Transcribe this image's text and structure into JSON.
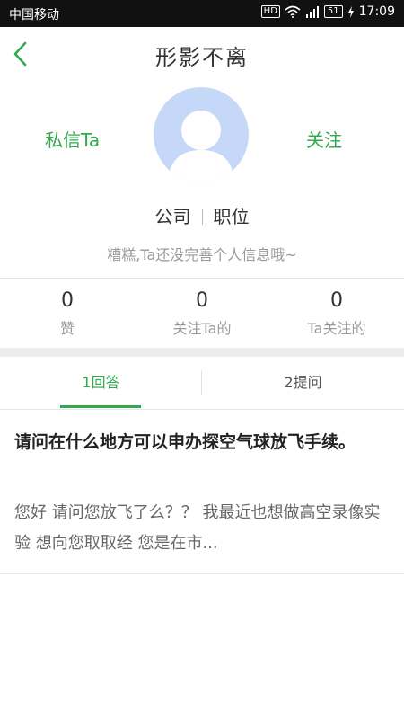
{
  "status_bar": {
    "carrier": "中国移动",
    "hd": "HD",
    "battery": "51",
    "time": "17:09"
  },
  "header": {
    "title": "形影不离",
    "back_icon": "chevron-left-icon"
  },
  "profile": {
    "message_label": "私信Ta",
    "follow_label": "关注",
    "company": "公司",
    "position": "职位",
    "bio": "糟糕,Ta还没完善个人信息哦~"
  },
  "stats": [
    {
      "value": "0",
      "label": "赞"
    },
    {
      "value": "0",
      "label": "关注Ta的"
    },
    {
      "value": "0",
      "label": "Ta关注的"
    }
  ],
  "tabs": [
    {
      "label": "1回答",
      "active": true
    },
    {
      "label": "2提问",
      "active": false
    }
  ],
  "answers": [
    {
      "question": "请问在什么地方可以申办探空气球放飞手续。",
      "excerpt": "您好   请问您放飞了么？？   我最近也想做高空录像实验    想向您取取经   您是在市..."
    }
  ],
  "colors": {
    "accent": "#2faa4c",
    "avatar_bg": "#c6d8f7"
  }
}
